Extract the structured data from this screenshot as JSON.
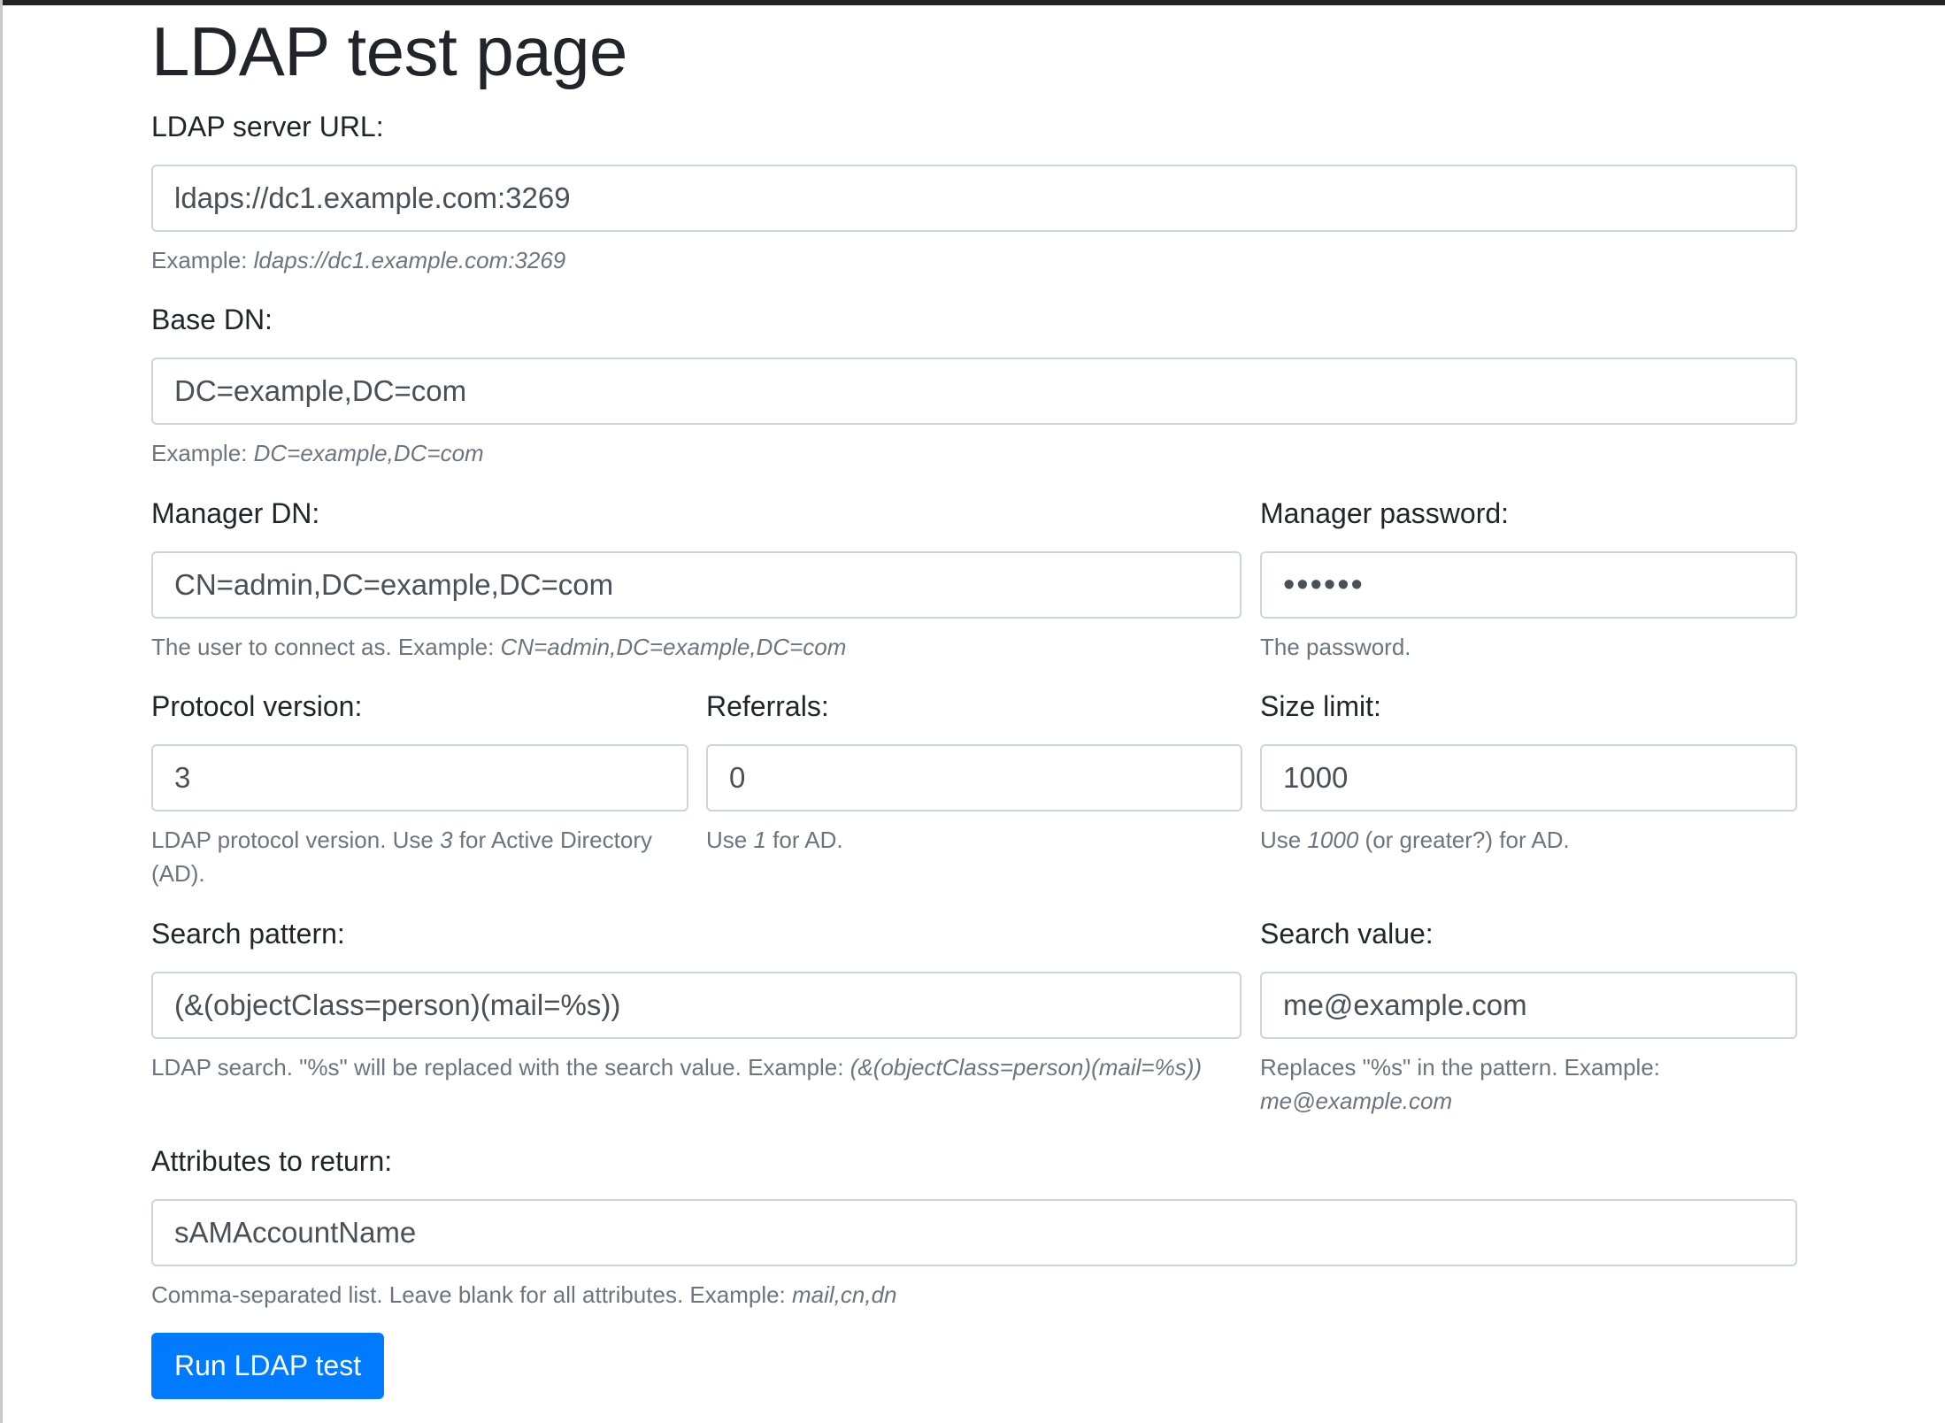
{
  "page": {
    "title": "LDAP test page"
  },
  "fields": {
    "server_url": {
      "label": "LDAP server URL:",
      "value": "ldaps://dc1.example.com:3269",
      "hint_prefix": "Example: ",
      "hint_example": "ldaps://dc1.example.com:3269"
    },
    "base_dn": {
      "label": "Base DN:",
      "value": "DC=example,DC=com",
      "hint_prefix": "Example: ",
      "hint_example": "DC=example,DC=com"
    },
    "manager_dn": {
      "label": "Manager DN:",
      "value": "CN=admin,DC=example,DC=com",
      "hint_prefix": "The user to connect as. Example: ",
      "hint_example": "CN=admin,DC=example,DC=com"
    },
    "manager_password": {
      "label": "Manager password:",
      "value": "••••••",
      "hint": "The password."
    },
    "protocol_version": {
      "label": "Protocol version:",
      "value": "3",
      "hint_prefix": "LDAP protocol version. Use ",
      "hint_example": "3",
      "hint_suffix": " for Active Directory (AD)."
    },
    "referrals": {
      "label": "Referrals:",
      "value": "0",
      "hint_prefix": "Use ",
      "hint_example": "1",
      "hint_suffix": " for AD."
    },
    "size_limit": {
      "label": "Size limit:",
      "value": "1000",
      "hint_prefix": "Use ",
      "hint_example": "1000",
      "hint_suffix": " (or greater?) for AD."
    },
    "search_pattern": {
      "label": "Search pattern:",
      "value": "(&(objectClass=person)(mail=%s))",
      "hint_prefix": "LDAP search. \"%s\" will be replaced with the search value. Example: ",
      "hint_example": "(&(objectClass=person)(mail=%s))"
    },
    "search_value": {
      "label": "Search value:",
      "value": "me@example.com",
      "hint_prefix": "Replaces \"%s\" in the pattern. Example: ",
      "hint_example": "me@example.com"
    },
    "attributes": {
      "label": "Attributes to return:",
      "value": "sAMAccountName",
      "hint_prefix": "Comma-separated list. Leave blank for all attributes. Example: ",
      "hint_example": "mail,cn,dn"
    }
  },
  "actions": {
    "run_label": "Run LDAP test"
  },
  "colors": {
    "primary": "#007bff",
    "text": "#212529",
    "muted": "#6c757d",
    "input_border": "#ced4da"
  }
}
